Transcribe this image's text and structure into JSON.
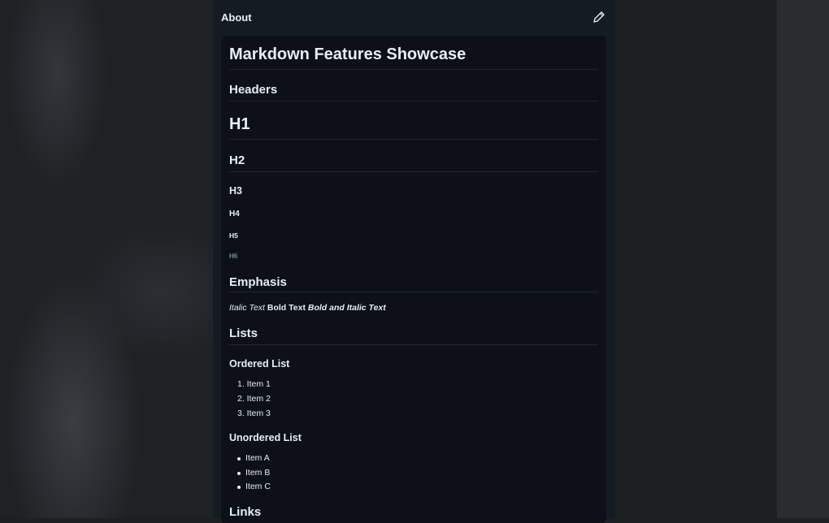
{
  "panel": {
    "title": "About",
    "edit_icon": "pencil-icon"
  },
  "doc": {
    "title": "Markdown Features Showcase",
    "headers_section": "Headers",
    "h1": "H1",
    "h2": "H2",
    "h3": "H3",
    "h4": "H4",
    "h5": "H5",
    "h6": "H6",
    "emphasis_section": "Emphasis",
    "emphasis": {
      "italic": "Italic Text",
      "bold": "Bold Text",
      "bold_italic": "Bold and Italic Text"
    },
    "lists_section": "Lists",
    "ordered_title": "Ordered List",
    "ordered_items": [
      "1. Item 1",
      "2. Item 2",
      "3. Item 3"
    ],
    "unordered_title": "Unordered List",
    "unordered_items": [
      "Item A",
      "Item B",
      "Item C"
    ],
    "links_section": "Links"
  },
  "colors": {
    "panel_bg": "#151b22",
    "card_bg": "#0d1117",
    "text": "#e6edf3",
    "muted": "#7d8590",
    "rule": "#21262d"
  }
}
